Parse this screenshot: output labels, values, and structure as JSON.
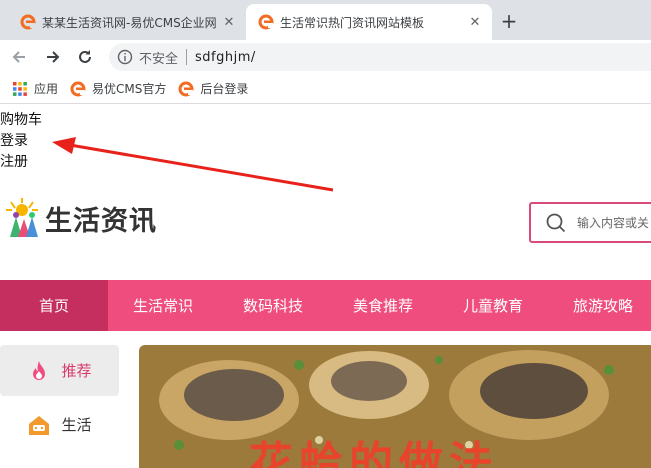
{
  "browser": {
    "tabs": [
      {
        "title": "某某生活资讯网-易优CMS企业网",
        "active": false
      },
      {
        "title": "生活常识热门资讯网站模板",
        "active": true
      }
    ],
    "address": {
      "security_label": "不安全",
      "url": "sdfghjm/"
    },
    "bookmarks": [
      {
        "label": "应用",
        "icon": "apps-grid-icon"
      },
      {
        "label": "易优CMS官方",
        "icon": "eyou-icon"
      },
      {
        "label": "后台登录",
        "icon": "eyou-icon"
      }
    ]
  },
  "site": {
    "top_links": [
      "购物车",
      "登录",
      "注册"
    ],
    "logo_text": "生活资讯",
    "search_placeholder": "输入内容或关",
    "nav": [
      "首页",
      "生活常识",
      "数码科技",
      "美食推荐",
      "儿童教育",
      "旅游攻略"
    ],
    "sidebar": [
      {
        "label": "推荐",
        "icon": "flame-icon",
        "active": true
      },
      {
        "label": "生活",
        "icon": "house-icon",
        "active": false
      }
    ],
    "banner_caption": "花蛤的做法"
  },
  "colors": {
    "accent": "#ee4d7e",
    "accent_dark": "#c42f60",
    "arrow": "#e8221b"
  }
}
